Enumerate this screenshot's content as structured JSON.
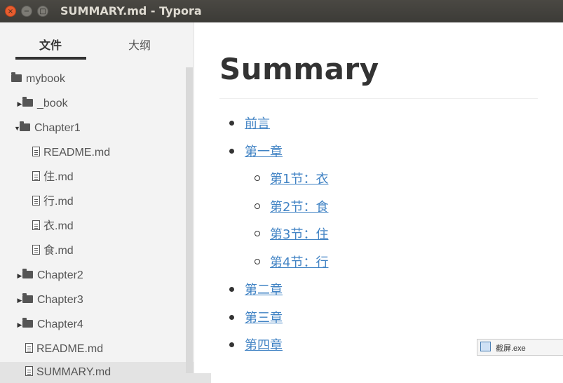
{
  "window": {
    "title": "SUMMARY.md - Typora",
    "buttons": {
      "close": "×",
      "minimize": "−",
      "maximize": "□"
    }
  },
  "sidebar": {
    "tabs": [
      {
        "label": "文件",
        "active": true
      },
      {
        "label": "大纲",
        "active": false
      }
    ],
    "tree": [
      {
        "label": "mybook",
        "type": "folder"
      },
      {
        "label": "_book",
        "type": "folder",
        "expanded": false
      },
      {
        "label": "Chapter1",
        "type": "folder",
        "expanded": true
      },
      {
        "label": "README.md",
        "type": "file"
      },
      {
        "label": "住.md",
        "type": "file"
      },
      {
        "label": "行.md",
        "type": "file"
      },
      {
        "label": "衣.md",
        "type": "file"
      },
      {
        "label": "食.md",
        "type": "file"
      },
      {
        "label": "Chapter2",
        "type": "folder",
        "expanded": false
      },
      {
        "label": "Chapter3",
        "type": "folder",
        "expanded": false
      },
      {
        "label": "Chapter4",
        "type": "folder",
        "expanded": false
      },
      {
        "label": "README.md",
        "type": "file"
      },
      {
        "label": "SUMMARY.md",
        "type": "file",
        "active": true
      }
    ]
  },
  "document": {
    "heading": "Summary",
    "items": [
      {
        "label": "前言"
      },
      {
        "label": "第一章",
        "children": [
          {
            "label": "第1节：衣"
          },
          {
            "label": "第2节：食"
          },
          {
            "label": "第3节：住"
          },
          {
            "label": "第4节：行"
          }
        ]
      },
      {
        "label": "第二章"
      },
      {
        "label": "第三章"
      },
      {
        "label": "第四章"
      }
    ]
  },
  "taskbar_tip": {
    "label": "截屏.exe"
  },
  "colors": {
    "link": "#4183c4",
    "titlebar": "#3c3b37",
    "close_button": "#e85d2f"
  }
}
